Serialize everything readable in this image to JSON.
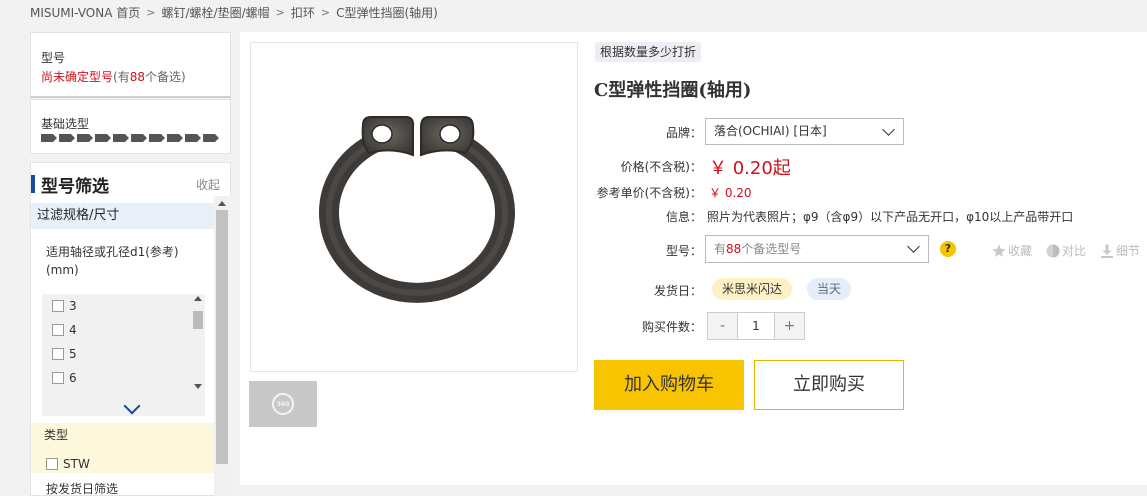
{
  "breadcrumb": {
    "items": [
      "MISUMI-VONA 首页",
      "螺钉/螺栓/垫圈/螺帽",
      "扣环",
      "C型弹性挡圈(轴用)"
    ],
    "separator": ">"
  },
  "model_box": {
    "label": "型号",
    "status_prefix": "尚未确定型号",
    "status_paren_open": "(有",
    "status_count": "88",
    "status_suffix": "个备选)"
  },
  "basic_select": {
    "label": "基础选型",
    "step_arrows": 10
  },
  "filter": {
    "title": "型号筛选",
    "collapse": "收起",
    "group": "过滤规格/尺寸",
    "param_label": "适用轴径或孔径d1(参考)(mm)",
    "options": [
      "3",
      "4",
      "5",
      "6"
    ],
    "type_label": "类型",
    "type_option": "STW",
    "ship_filter_label": "按发货日筛选"
  },
  "product": {
    "discount_tag": "根据数量多少打折",
    "title": "C型弹性挡圈(轴用)",
    "corner_mark": "",
    "brand_label": "品牌：",
    "brand_value": "落合(OCHIAI) [日本]",
    "price_label": "价格(不含税)：",
    "price_value": "￥ 0.20起",
    "ref_price_label": "参考单价(不含税)：",
    "ref_price_value": "￥ 0.20",
    "info_label": "信息：",
    "info_text": "照片为代表照片；φ9（含φ9）以下产品无开口，φ10以上产品带开口",
    "model_label": "型号：",
    "model_prefix": "有",
    "model_count": "88",
    "model_suffix": "个备选型号",
    "help": "?",
    "tools": {
      "favorite": "收藏",
      "compare": "对比",
      "detail": "细节"
    },
    "ship_label": "发货日：",
    "ship_option_a": "米思米闪达",
    "ship_option_b": "当天",
    "qty_label": "购买件数：",
    "qty_minus": "-",
    "qty_value": "1",
    "qty_plus": "+",
    "add_to_cart": "加入购物车",
    "buy_now": "立即购买",
    "view360_label": "360"
  },
  "colors": {
    "accent_red": "#d0101b",
    "cart_yellow": "#f8c400",
    "filter_blue": "#1a4aa0"
  }
}
